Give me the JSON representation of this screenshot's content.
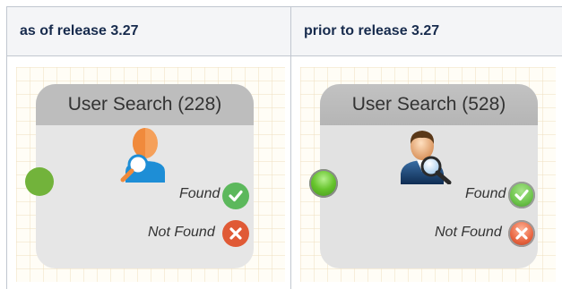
{
  "table": {
    "headers": [
      "as of release 3.27",
      "prior to release 3.27"
    ]
  },
  "new_node": {
    "title": "User Search (228)",
    "found_label": "Found",
    "not_found_label": "Not Found",
    "icon": "user-search-icon",
    "colors": {
      "connector": "#72b33b",
      "found": "#5cb85c",
      "not_found": "#e05a36"
    }
  },
  "old_node": {
    "title": "User Search (528)",
    "found_label": "Found",
    "not_found_label": "Not Found",
    "icon": "user-search-icon",
    "colors": {
      "connector": "#66c42c",
      "found": "#6cc34a",
      "not_found": "#e8643f"
    }
  }
}
